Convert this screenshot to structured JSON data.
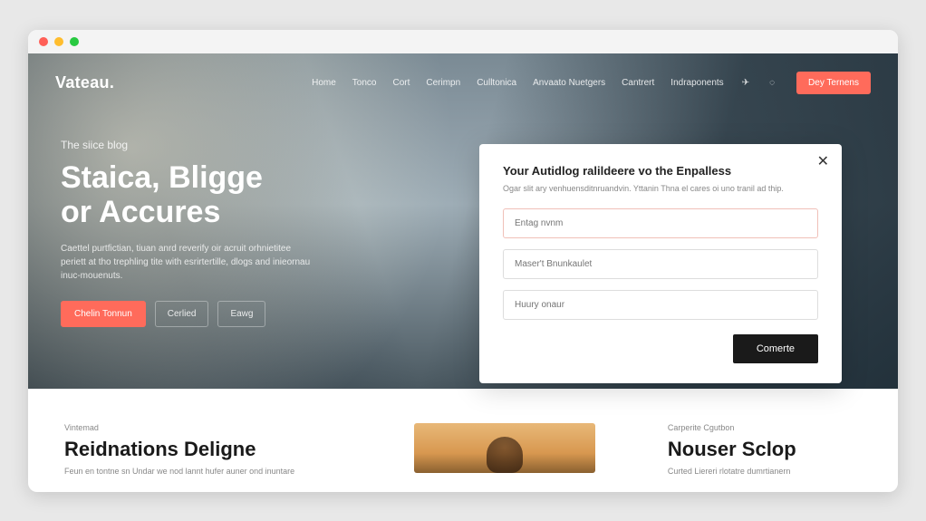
{
  "brand": "Vateau.",
  "nav": {
    "items": [
      "Home",
      "Tonco",
      "Cort",
      "Cerimpn",
      "Culltonica",
      "Anvaato Nuetgers",
      "Cantrert",
      "Indraponents"
    ],
    "cta_label": "Dey Ternens"
  },
  "hero": {
    "eyebrow": "The siice blog",
    "title_line1": "Staica, Bligge",
    "title_line2": "or Accures",
    "description": "Caettel purtfictian, tiuan anrd reverify oir acruit orhnietitee periett at tho trephling tite with esrirtertille, dlogs and inieornau inuc-mouenuts.",
    "btn_primary": "Chelin Tonnun",
    "btn_secondary1": "Cerlied",
    "btn_secondary2": "Eawg"
  },
  "modal": {
    "title": "Your Autidlog ralildeere vo the Enpalless",
    "subtitle": "Ogar slit ary venhuensditnruandvin. Yttanin Thna el cares oi uno tranil ad thip.",
    "field1_placeholder": "Entag nvnm",
    "field2_placeholder": "Maser't Bnunkaulet",
    "field3_placeholder": "Huury onaur",
    "submit_label": "Comerte"
  },
  "cards": [
    {
      "eyebrow": "Vintemad",
      "title": "Reidnations Deligne",
      "description": "Feun en tontne sn Undar we nod lannt hufer auner ond inuntare"
    },
    {
      "eyebrow": "Carperite Cgutbon",
      "title": "Nouser Sclop",
      "description": "Curted Liereri rlotatre dumrtianern"
    }
  ],
  "colors": {
    "accent": "#ff6b5b",
    "dark": "#1a1a1a"
  }
}
